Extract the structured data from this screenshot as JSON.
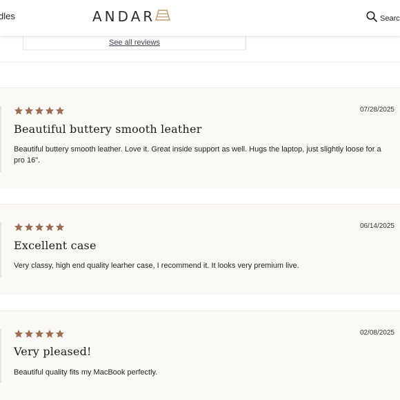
{
  "header": {
    "nav_partial": "dles",
    "brand": "ANDAR",
    "search_label": "Search"
  },
  "summary": {
    "see_all_reviews": "See all reviews"
  },
  "colors": {
    "star": "#9b6d57",
    "review_bg": "#fbf9f6",
    "logo_mark": "#c8a883"
  },
  "reviews": [
    {
      "rating": 5,
      "date": "07/28/2025",
      "title": "Beautiful buttery smooth leather",
      "body": "Beautiful buttery smooth leather. Love it. Great inside support as well. Hugs the laptop, just slightly loose for a pro 16\"."
    },
    {
      "rating": 5,
      "date": "06/14/2025",
      "title": "Excellent case",
      "body": "Very classy, high end quality learher case, I recommend it. It looks very premium live."
    },
    {
      "rating": 5,
      "date": "02/08/2025",
      "title": "Very pleased!",
      "body": "Beautiful quality fits my MacBook perfectly."
    }
  ]
}
